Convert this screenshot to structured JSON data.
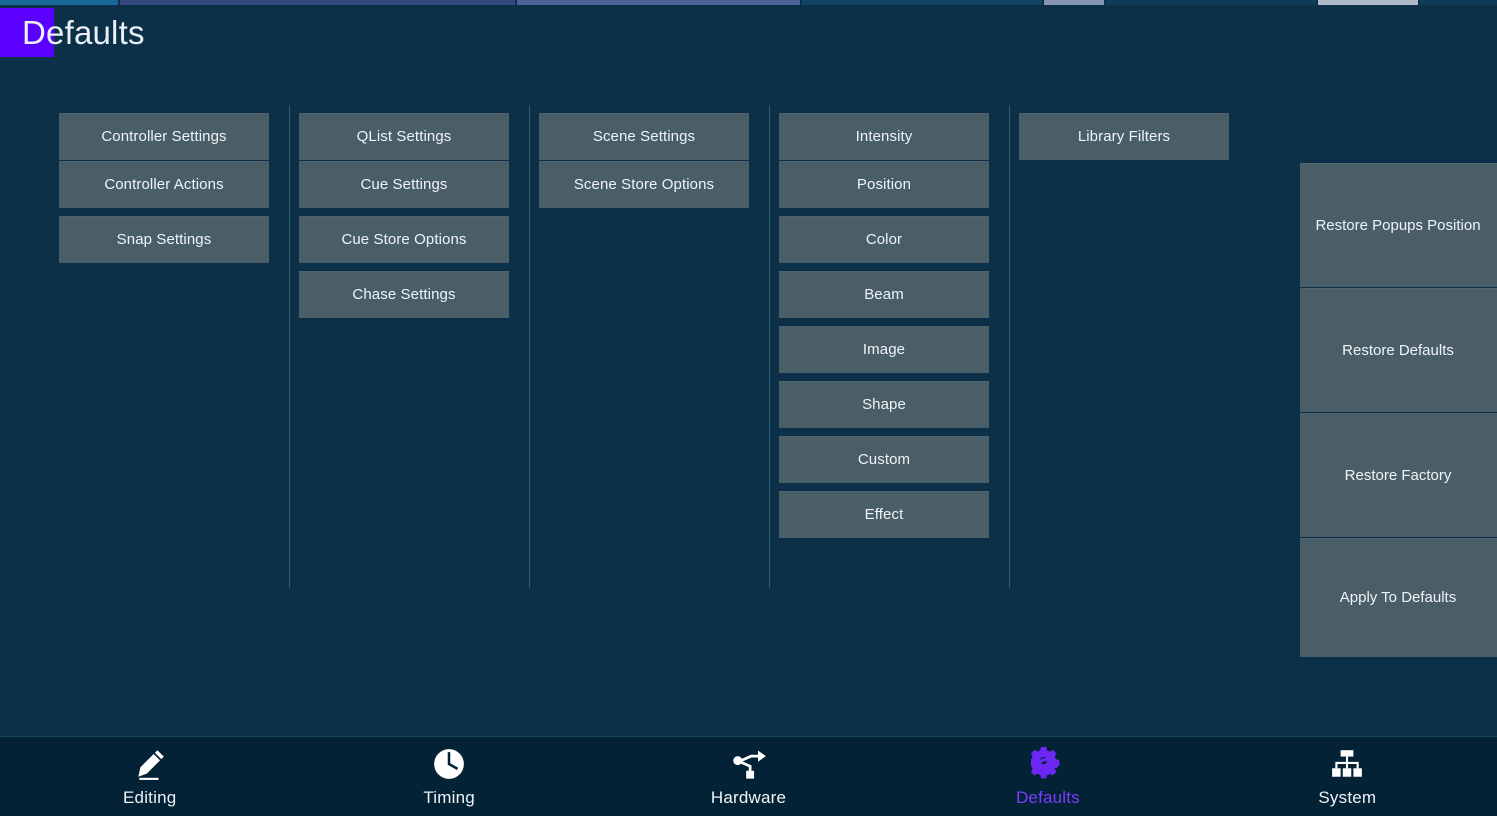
{
  "page": {
    "title": "Defaults",
    "badge_color": "#5a00ff",
    "background_color": "#0b3047",
    "button_color": "#4a5e67",
    "nav_bar_color": "#042235",
    "active_nav_color": "#7b3cff"
  },
  "columns": [
    {
      "name": "controller",
      "buttons": [
        {
          "label": "Controller Settings"
        },
        {
          "label": "Controller Actions"
        },
        {
          "label": "Snap Settings"
        }
      ]
    },
    {
      "name": "qlist-cue-chase",
      "buttons": [
        {
          "label": "QList Settings"
        },
        {
          "label": "Cue Settings"
        },
        {
          "label": "Cue Store Options"
        },
        {
          "label": "Chase Settings"
        }
      ]
    },
    {
      "name": "scene",
      "buttons": [
        {
          "label": "Scene Settings"
        },
        {
          "label": "Scene Store Options"
        }
      ]
    },
    {
      "name": "attributes",
      "buttons": [
        {
          "label": "Intensity"
        },
        {
          "label": "Position"
        },
        {
          "label": "Color"
        },
        {
          "label": "Beam"
        },
        {
          "label": "Image"
        },
        {
          "label": "Shape"
        },
        {
          "label": "Custom"
        },
        {
          "label": "Effect"
        }
      ]
    },
    {
      "name": "library",
      "buttons": [
        {
          "label": "Library Filters"
        }
      ]
    }
  ],
  "right_panel": {
    "buttons": [
      {
        "label": "Restore Popups Position"
      },
      {
        "label": "Restore Defaults"
      },
      {
        "label": "Restore Factory"
      },
      {
        "label": "Apply To Defaults"
      }
    ]
  },
  "bottom_nav": {
    "items": [
      {
        "label": "Editing",
        "icon": "pencil-icon",
        "active": false
      },
      {
        "label": "Timing",
        "icon": "clock-icon",
        "active": false
      },
      {
        "label": "Hardware",
        "icon": "usb-icon",
        "active": false
      },
      {
        "label": "Defaults",
        "icon": "gear-icon",
        "active": true
      },
      {
        "label": "System",
        "icon": "hierarchy-icon",
        "active": false
      }
    ]
  }
}
